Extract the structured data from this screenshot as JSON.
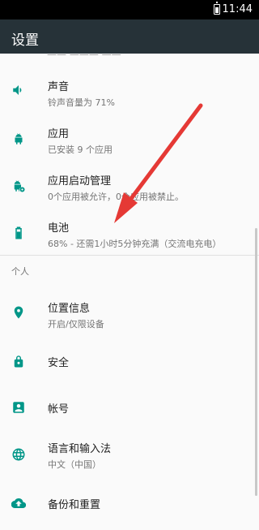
{
  "status_bar": {
    "time": "11:44"
  },
  "app_bar": {
    "title": "设置"
  },
  "partial_top_text": "——  ——— ——",
  "items": [
    {
      "title": "声音",
      "subtitle": "铃声音量为 71%"
    },
    {
      "title": "应用",
      "subtitle": "已安装 9 个应用"
    },
    {
      "title": "应用启动管理",
      "subtitle": "0个应用被允许，0个应用被禁止。"
    },
    {
      "title": "电池",
      "subtitle": "68% - 还需1小时5分钟充满（交流电充电）"
    },
    {
      "title": "位置信息",
      "subtitle": "开启/仅限设备"
    },
    {
      "title": "安全"
    },
    {
      "title": "帐号"
    },
    {
      "title": "语言和输入法",
      "subtitle": "中文（中国）"
    },
    {
      "title": "备份和重置"
    }
  ],
  "section_personal": "个人",
  "colors": {
    "accent": "#009688",
    "app_bar": "#263238",
    "arrow": "#e53935"
  }
}
